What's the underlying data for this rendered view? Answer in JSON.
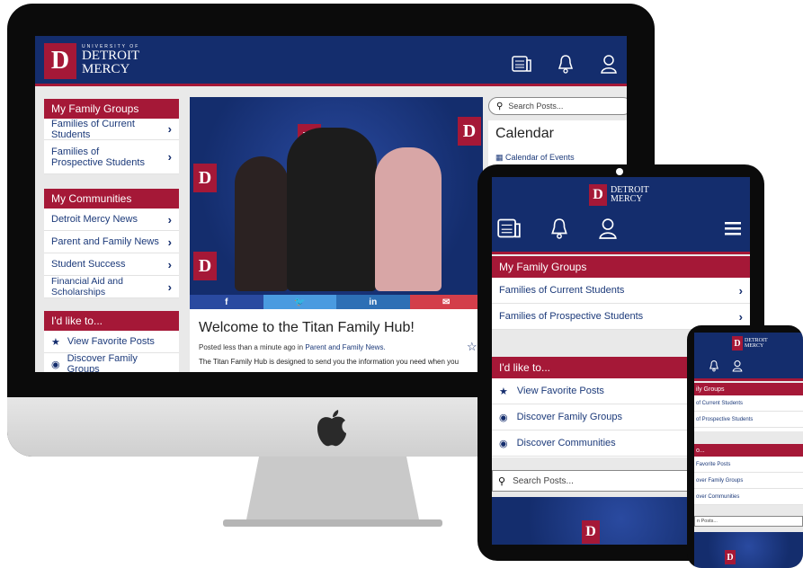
{
  "brand": {
    "university": "UNIVERSITY OF",
    "line1": "DETROIT",
    "line2": "MERCY",
    "mark": "D"
  },
  "colors": {
    "navy": "#142d6d",
    "crimson": "#a51837"
  },
  "icons": [
    "news-icon",
    "bell-icon",
    "user-icon",
    "menu-icon",
    "search-icon",
    "star-icon",
    "compass-icon",
    "calendar-icon"
  ],
  "desktop": {
    "family_groups": {
      "title": "My Family Groups",
      "items": [
        "Families of Current Students",
        "Families of Prospective Students"
      ]
    },
    "communities": {
      "title": "My Communities",
      "items": [
        "Detroit Mercy News",
        "Parent and Family News",
        "Student Success",
        "Financial Aid and Scholarships"
      ]
    },
    "like_to": {
      "title": "I'd like to...",
      "items": [
        "View Favorite Posts",
        "Discover Family Groups"
      ]
    },
    "search_placeholder": "Search Posts...",
    "calendar": {
      "title": "Calendar",
      "link": "Calendar of Events"
    },
    "post": {
      "title": "Welcome to the Titan Family Hub!",
      "meta_prefix": "Posted less than a minute ago in",
      "meta_link": "Parent and Family News.",
      "body": "The Titan Family Hub is designed to send you the information you need when you"
    },
    "share": [
      "f",
      "🐦",
      "in",
      "✉"
    ]
  },
  "tablet": {
    "family_groups": {
      "title": "My Family Groups",
      "items": [
        "Families of Current Students",
        "Families of Prospective Students"
      ]
    },
    "like_to": {
      "title": "I'd like to...",
      "items": [
        "View Favorite Posts",
        "Discover Family Groups",
        "Discover Communities"
      ]
    },
    "search_placeholder": "Search Posts..."
  },
  "phone": {
    "family_groups": {
      "title": "ily Groups",
      "items": [
        "of Current Students",
        "of Prospective Students"
      ]
    },
    "like_to": {
      "title": "o...",
      "items": [
        "Favorite Posts",
        "over Family Groups",
        "over Communities"
      ]
    },
    "search_placeholder": "n Posts..."
  }
}
